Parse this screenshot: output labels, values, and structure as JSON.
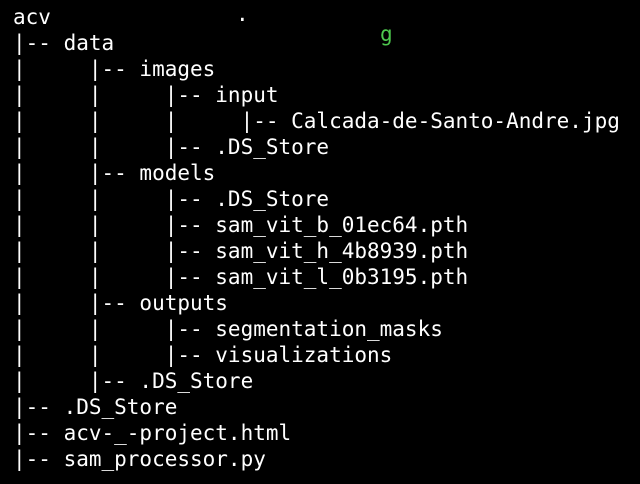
{
  "terminal": {
    "background": "#000000",
    "text_color": "#ffffff",
    "accent_color": "#4ec94e",
    "tree_lines": [
      "acv",
      "|-- data",
      "|     |-- images",
      "|     |     |-- input",
      "|     |     |     |-- Calcada-de-Santo-Andre.jpg",
      "|     |     |-- .DS_Store",
      "|     |-- models",
      "|     |     |-- .DS_Store",
      "|     |     |-- sam_vit_b_01ec64.pth",
      "|     |     |-- sam_vit_h_4b8939.pth",
      "|     |     |-- sam_vit_l_0b3195.pth",
      "|     |-- outputs",
      "|     |     |-- segmentation_masks",
      "|     |     |-- visualizations",
      "|     |-- .DS_Store",
      "|-- .DS_Store",
      "|-- acv-_-project.html",
      "|-- sam_processor.py"
    ]
  }
}
